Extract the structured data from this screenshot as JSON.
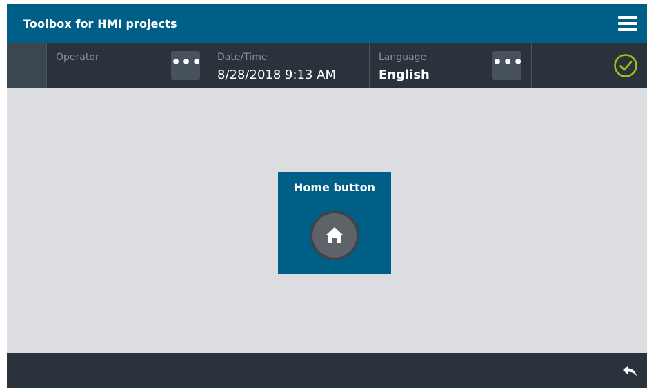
{
  "window": {
    "title": "Toolbox for HMI projects",
    "menu_icon": "hamburger-menu-icon"
  },
  "status_bar": {
    "operator": {
      "label": "Operator",
      "value": ""
    },
    "datetime": {
      "label": "Date/Time",
      "value": "8/28/2018 9:13 AM"
    },
    "language": {
      "label": "Language",
      "value": "English"
    },
    "more_button_glyph": "•••",
    "status_icon": "check-circle-icon",
    "status_color": "#9bc31b"
  },
  "main": {
    "tile": {
      "title": "Home button",
      "icon": "home-icon"
    }
  },
  "bottom_bar": {
    "back_icon": "back-arrow-icon"
  },
  "colors": {
    "header": "#005f87",
    "statusbar": "#2a323b",
    "background": "#dcdde1",
    "button_gray": "#48525c"
  }
}
